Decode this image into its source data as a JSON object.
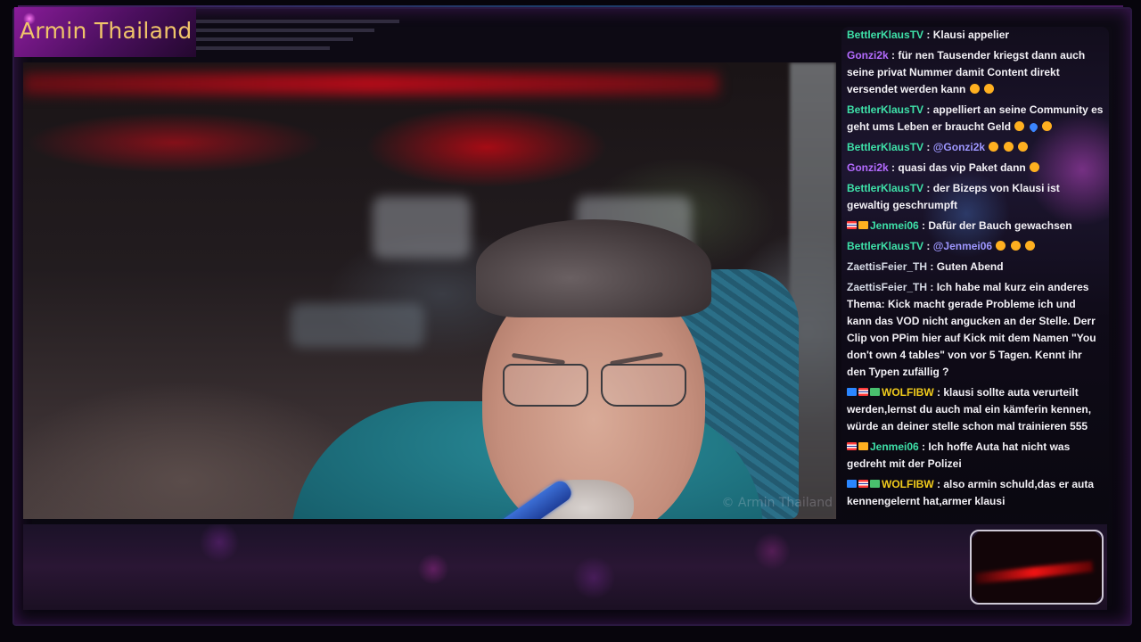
{
  "stream": {
    "title": "Armin Thailand",
    "watermark": "© Armin Thailand"
  },
  "colors": {
    "title_text": "#f0c46a",
    "username_green": "#3ee0a8",
    "username_purple": "#b46bff",
    "username_gray": "#d6dbe6",
    "username_yellow": "#f2cc1c",
    "mention": "#9e97ff",
    "accent_purple": "#8a1c9a"
  },
  "chat": {
    "messages": [
      {
        "user": "BettlerKlausTV",
        "badges": [],
        "text": "Klausi appelier",
        "color": "green"
      },
      {
        "user": "Gonzi2k",
        "badges": [],
        "text": "für nen Tausender kriegst dann auch seine privat Nummer damit Content direkt versendet werden kann",
        "emotes": [
          "laughing-emoji",
          "heart-eyes-emoji"
        ],
        "color": "purple"
      },
      {
        "user": "BettlerKlausTV",
        "badges": [],
        "text": "appelliert an seine Community es geht ums Leben er braucht Geld",
        "emotes": [
          "heart-eyes-emoji",
          "blue-heart-emoji",
          "heart-eyes-emoji"
        ],
        "color": "green"
      },
      {
        "user": "BettlerKlausTV",
        "badges": [],
        "mention": "@Gonzi2k",
        "text": "",
        "emotes": [
          "heart-eyes-emoji",
          "heart-eyes-emoji",
          "heart-eyes-emoji"
        ],
        "color": "green"
      },
      {
        "user": "Gonzi2k",
        "badges": [],
        "text": "quasi das vip Paket dann",
        "emotes": [
          "heart-eyes-emoji"
        ],
        "color": "purple"
      },
      {
        "user": "BettlerKlausTV",
        "badges": [],
        "text": "der Bizeps von Klausi ist gewaltig geschrumpft",
        "color": "green"
      },
      {
        "user": "Jenmei06",
        "badges": [
          "thai-flag-badge",
          "crown-badge"
        ],
        "text": "Dafür der Bauch gewachsen",
        "color": "green"
      },
      {
        "user": "BettlerKlausTV",
        "badges": [],
        "mention": "@Jenmei06",
        "text": "",
        "emotes": [
          "heart-eyes-emoji",
          "heart-eyes-emoji",
          "heart-eyes-emoji"
        ],
        "color": "green"
      },
      {
        "user": "ZaettisFeier_TH",
        "badges": [],
        "text": "Guten Abend",
        "color": "gray"
      },
      {
        "user": "ZaettisFeier_TH",
        "badges": [],
        "text": "Ich habe mal kurz ein anderes Thema: Kick macht gerade Probleme ich und kann das VOD nicht angucken an der Stelle. Derr Clip von PPim hier auf Kick mit dem Namen \"You don't own 4 tables\" von vor 5 Tagen. Kennt ihr den Typen zufällig ?",
        "color": "gray"
      },
      {
        "user": "WOLFIBW",
        "badges": [
          "prime-badge",
          "thai-flag-badge",
          "sub-badge"
        ],
        "text": "klausi sollte auta verurteilt werden,lernst du auch mal ein kämferin kennen, würde an deiner stelle schon mal trainieren 555",
        "color": "yellow"
      },
      {
        "user": "Jenmei06",
        "badges": [
          "thai-flag-badge",
          "crown-badge"
        ],
        "text": "Ich hoffe Auta hat nicht was gedreht mit der Polizei",
        "color": "green"
      },
      {
        "user": "WOLFIBW",
        "badges": [
          "prime-badge",
          "thai-flag-badge",
          "sub-badge"
        ],
        "text": "also armin schuld,das er auta kennengelernt hat,armer klausi",
        "color": "yellow"
      }
    ]
  }
}
